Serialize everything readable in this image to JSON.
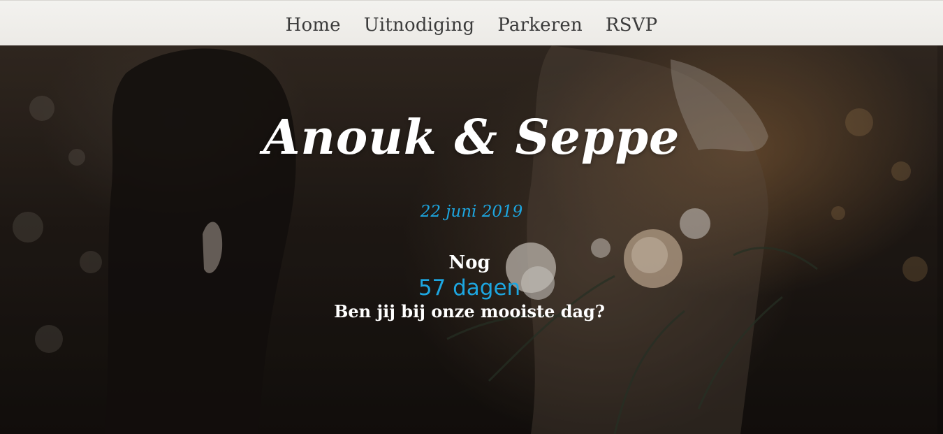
{
  "nav": {
    "items": [
      {
        "label": "Home"
      },
      {
        "label": "Uitnodiging"
      },
      {
        "label": "Parkeren"
      },
      {
        "label": "RSVP"
      }
    ]
  },
  "hero": {
    "title": "Anouk & Seppe",
    "date": "22 juni 2019",
    "countdown_prefix": "Nog",
    "countdown_value": "57 dagen",
    "tagline": "Ben jij bij onze mooiste dag?"
  },
  "colors": {
    "accent": "#1da6e0",
    "nav_background": "#eceae6",
    "nav_text": "#3b3b3b",
    "hero_text": "#ffffff"
  }
}
